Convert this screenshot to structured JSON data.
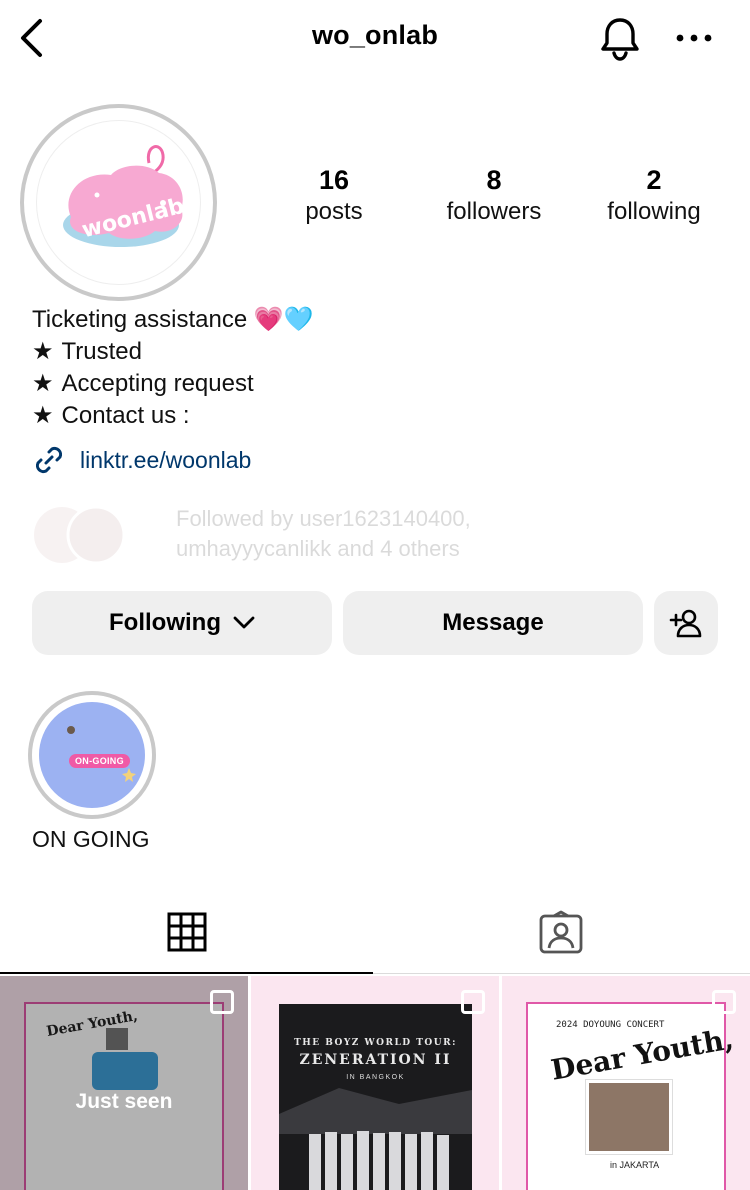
{
  "header": {
    "username": "wo_onlab",
    "icons": {
      "back": "chevron-left-icon",
      "bell": "bell-icon",
      "more": "more-horizontal-icon"
    }
  },
  "profile": {
    "avatar_text": "woonlab",
    "stats": [
      {
        "value": "16",
        "label": "posts"
      },
      {
        "value": "8",
        "label": "followers"
      },
      {
        "value": "2",
        "label": "following"
      }
    ]
  },
  "bio": {
    "line1": "Ticketing assistance",
    "line1_emoji": "💗🩵",
    "star": "★",
    "line2": "Trusted",
    "line3": "Accepting request",
    "line4": "Contact us :",
    "link": "linktr.ee/woonlab"
  },
  "mutual": {
    "line1": "Followed by user1623140400,",
    "line2": "umhayyycanlikk and 4 others"
  },
  "actions": {
    "following_label": "Following",
    "message_label": "Message"
  },
  "highlight": {
    "badge": "ON-GOING",
    "label": "ON GOING"
  },
  "grid": {
    "post1": {
      "overlay": "Just seen",
      "title": "Dear Youth,"
    },
    "post2": {
      "line1": "THE BOYZ WORLD TOUR:",
      "line2": "ZENERATION II",
      "line3": "IN BANGKOK"
    },
    "post3": {
      "top": "2024 DOYOUNG CONCERT",
      "title": "Dear Youth,",
      "loc": "in JAKARTA"
    }
  },
  "colors": {
    "link": "#00376b",
    "button_bg": "#efefef",
    "highlight_bg": "#9cb2f2",
    "brand_pink": "#e058a8"
  }
}
